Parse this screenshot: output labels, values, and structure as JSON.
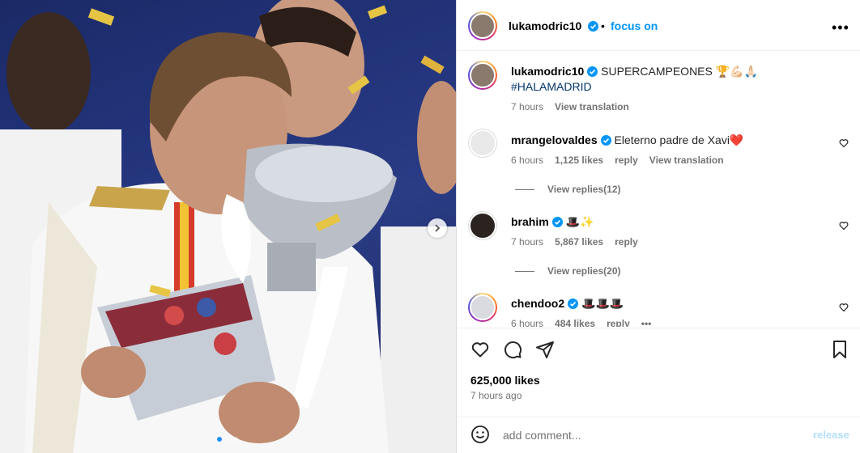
{
  "post": {
    "author": "lukamodric10",
    "follow_label": "focus on",
    "bullet": "•",
    "more": "•••",
    "caption_text": "SUPERCAMPEONES 🏆💪🏻🙏🏻",
    "caption_hashtag": "#HALAMADRID",
    "caption_time": "7 hours",
    "caption_translate": "View translation",
    "likes": "625,000 likes",
    "time_ago": "7 hours ago",
    "comment_placeholder": "add comment...",
    "release_label": "release"
  },
  "comments": [
    {
      "user": "mrangelovaldes",
      "text": "Eleterno padre de Xavi❤️",
      "time": "6 hours",
      "likes": "1,125 likes",
      "reply": "reply",
      "translate": "View translation",
      "replies": "View replies(12)"
    },
    {
      "user": "brahim",
      "text": "🎩✨",
      "time": "7 hours",
      "likes": "5,867 likes",
      "reply": "reply",
      "replies": "View replies(20)"
    },
    {
      "user": "chendoo2",
      "text": "🎩🎩🎩",
      "time": "6 hours",
      "likes": "484 likes",
      "reply": "reply",
      "more": "•••"
    }
  ],
  "colors": {
    "accent": "#0095f6",
    "verified": "#0095f6",
    "muted": "#737373",
    "hashtag": "#00376b"
  },
  "icons": [
    "next-arrow-icon",
    "verified-icon",
    "heart-icon",
    "comment-icon",
    "share-icon",
    "bookmark-icon",
    "emoji-icon",
    "more-icon"
  ]
}
